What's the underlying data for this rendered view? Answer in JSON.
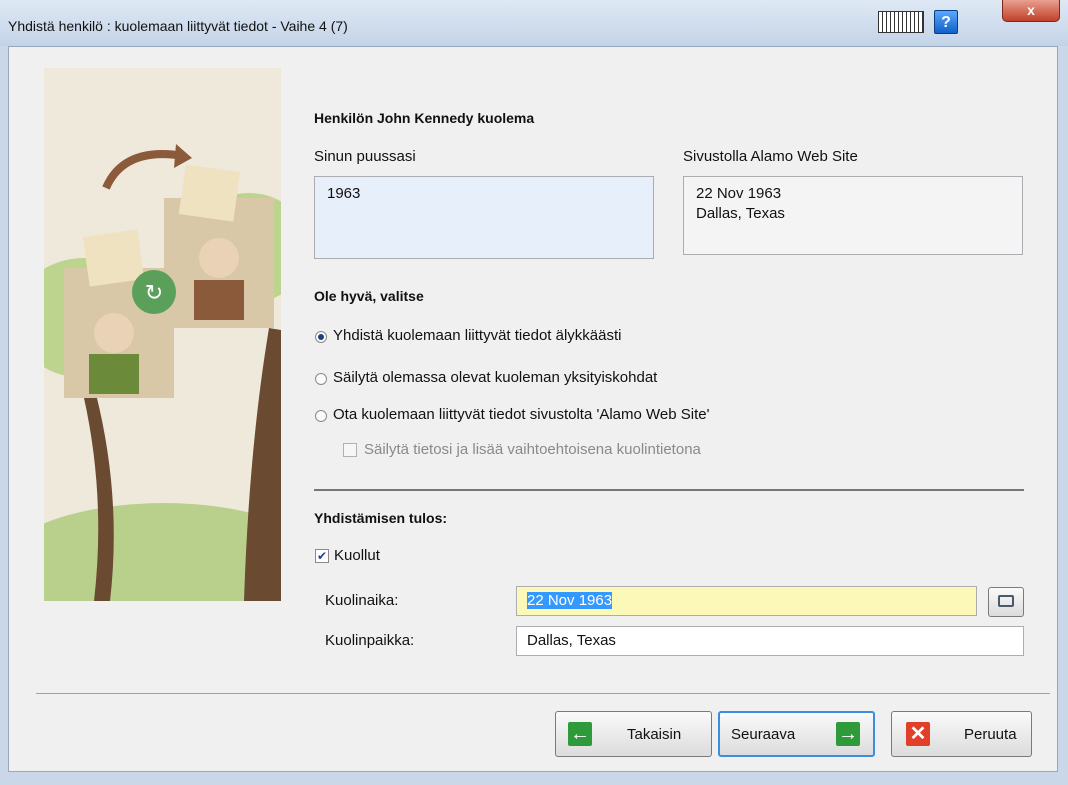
{
  "window": {
    "title": "Yhdistä henkilö : kuolemaan liittyvät tiedot - Vaihe 4 (7)",
    "help_label": "?",
    "close_label": "x"
  },
  "content": {
    "heading": "Henkilön John Kennedy kuolema",
    "left_label": "Sinun puussasi",
    "right_label": "Sivustolla Alamo Web Site",
    "left_value": "1963",
    "right_line1": "22 Nov 1963",
    "right_line2": "Dallas, Texas",
    "choose_heading": "Ole hyvä, valitse",
    "options": [
      "Yhdistä kuolemaan liittyvät tiedot älykkäästi",
      "Säilytä olemassa olevat kuoleman yksityiskohdat",
      "Ota kuolemaan liittyvät tiedot sivustolta 'Alamo Web Site'"
    ],
    "selected_option": 0,
    "sub_option": "Säilytä tietosi ja lisää vaihtoehtoisena kuolintietona",
    "result_heading": "Yhdistämisen tulos:",
    "deceased_label": "Kuollut",
    "deceased_checked": true,
    "death_date_label": "Kuolinaika:",
    "death_date_value": "22 Nov 1963",
    "death_place_label": "Kuolinpaikka:",
    "death_place_value": "Dallas, Texas"
  },
  "footer": {
    "back_label": "Takaisin",
    "next_label": "Seuraava",
    "cancel_label": "Peruuta"
  },
  "colors": {
    "back_icon": "#2e9a3a",
    "next_icon": "#2e9a3a",
    "cancel_icon": "#e0402a",
    "date_highlight": "#fbf8b8",
    "selection": "#3399ff"
  }
}
